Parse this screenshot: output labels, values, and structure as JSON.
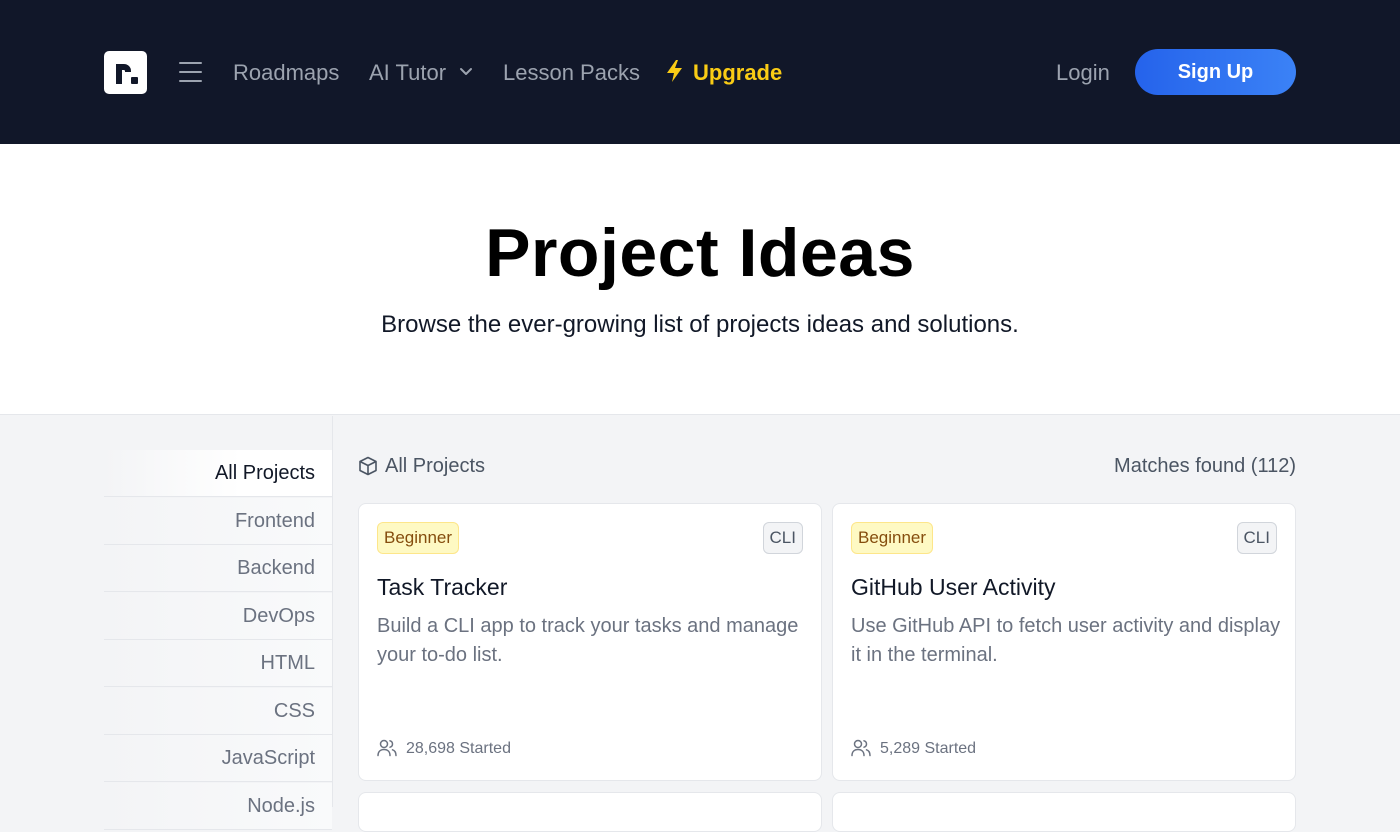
{
  "nav": {
    "logo_letter": "r.",
    "links": {
      "roadmaps": "Roadmaps",
      "ai_tutor": "AI Tutor",
      "lesson_packs": "Lesson Packs",
      "upgrade": "Upgrade"
    },
    "login": "Login",
    "signup": "Sign Up",
    "colors": {
      "background": "#111729",
      "upgrade": "#facc15",
      "signup": "#2563eb"
    },
    "icons": {
      "menu": "hamburger-icon",
      "dropdown": "chevron-down-icon",
      "upgrade": "lightning-bolt-icon"
    }
  },
  "hero": {
    "title": "Project Ideas",
    "subtitle": "Browse the ever-growing list of projects ideas and solutions."
  },
  "sidebar": {
    "items": [
      {
        "label": "All Projects",
        "active": true
      },
      {
        "label": "Frontend",
        "active": false
      },
      {
        "label": "Backend",
        "active": false
      },
      {
        "label": "DevOps",
        "active": false
      },
      {
        "label": "HTML",
        "active": false
      },
      {
        "label": "CSS",
        "active": false
      },
      {
        "label": "JavaScript",
        "active": false
      },
      {
        "label": "Node.js",
        "active": false
      }
    ]
  },
  "main": {
    "header_label": "All Projects",
    "header_icon": "cube-icon",
    "matches": "Matches found (112)",
    "cards": [
      {
        "level": "Beginner",
        "tag": "CLI",
        "title": "Task Tracker",
        "description": "Build a CLI app to track your tasks and manage your to-do list.",
        "started": "28,698 Started"
      },
      {
        "level": "Beginner",
        "tag": "CLI",
        "title": "GitHub User Activity",
        "description": "Use GitHub API to fetch user activity and display it in the terminal.",
        "started": "5,289 Started"
      }
    ]
  }
}
